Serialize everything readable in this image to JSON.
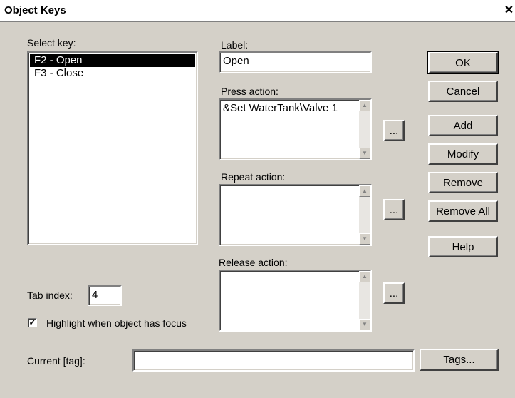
{
  "window": {
    "title": "Object Keys",
    "close_glyph": "✕"
  },
  "select_key": {
    "label": "Select key:",
    "items": [
      {
        "text": "F2 - Open",
        "selected": true
      },
      {
        "text": "F3 - Close",
        "selected": false
      }
    ]
  },
  "label_field": {
    "label": "Label:",
    "value": "Open"
  },
  "press_action": {
    "label": "Press action:",
    "value": "&Set WaterTank\\Valve 1",
    "browse": "..."
  },
  "repeat_action": {
    "label": "Repeat action:",
    "value": "",
    "browse": "..."
  },
  "release_action": {
    "label": "Release action:",
    "value": "",
    "browse": "..."
  },
  "tab_index": {
    "label": "Tab index:",
    "value": "4"
  },
  "highlight": {
    "label": "Highlight when object has focus",
    "checked": true,
    "check_glyph": "✓"
  },
  "current_tag": {
    "label": "Current [tag]:",
    "value": ""
  },
  "buttons": {
    "ok": "OK",
    "cancel": "Cancel",
    "add": "Add",
    "modify": "Modify",
    "remove": "Remove",
    "remove_all": "Remove All",
    "help": "Help",
    "tags": "Tags..."
  },
  "scroll_glyphs": {
    "up": "▲",
    "down": "▼"
  }
}
